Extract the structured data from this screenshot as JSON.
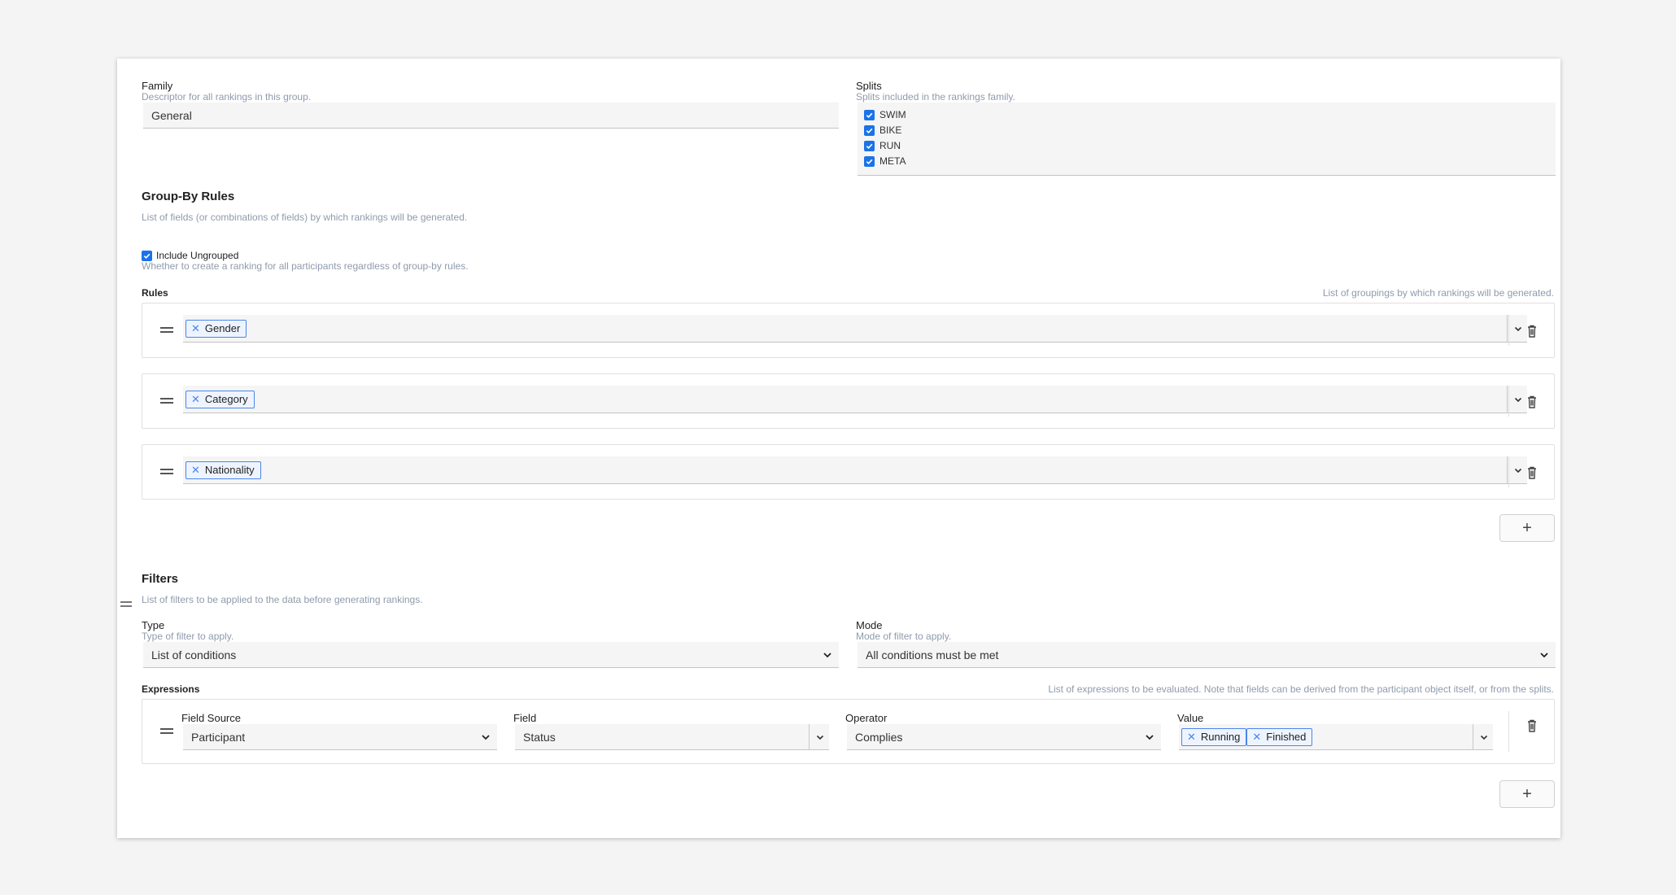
{
  "family": {
    "label": "Family",
    "description": "Descriptor for all rankings in this group.",
    "value": "General"
  },
  "splits": {
    "label": "Splits",
    "description": "Splits included in the rankings family.",
    "items": [
      {
        "label": "SWIM",
        "checked": true
      },
      {
        "label": "BIKE",
        "checked": true
      },
      {
        "label": "RUN",
        "checked": true
      },
      {
        "label": "META",
        "checked": true
      }
    ]
  },
  "group_by": {
    "title": "Group-By Rules",
    "description": "List of fields (or combinations of fields) by which rankings will be generated.",
    "include_ungrouped": {
      "label": "Include Ungrouped",
      "description": "Whether to create a ranking for all participants regardless of group-by rules.",
      "checked": true
    },
    "rules_label": "Rules",
    "rules_hint": "List of groupings by which rankings will be generated.",
    "rules": [
      {
        "tags": [
          "Gender"
        ]
      },
      {
        "tags": [
          "Category"
        ]
      },
      {
        "tags": [
          "Nationality"
        ]
      }
    ],
    "add_label": "+"
  },
  "filters": {
    "title": "Filters",
    "description": "List of filters to be applied to the data before generating rankings.",
    "type": {
      "label": "Type",
      "description": "Type of filter to apply.",
      "value": "List of conditions"
    },
    "mode": {
      "label": "Mode",
      "description": "Mode of filter to apply.",
      "value": "All conditions must be met"
    },
    "expressions_label": "Expressions",
    "expressions_hint": "List of expressions to be evaluated. Note that fields can be derived from the participant object itself, or from the splits.",
    "expression": {
      "field_source_label": "Field Source",
      "field_source_value": "Participant",
      "field_label": "Field",
      "field_value": "Status",
      "operator_label": "Operator",
      "operator_value": "Complies",
      "value_label": "Value",
      "value_tags": [
        "Running",
        "Finished"
      ]
    },
    "add_label": "+"
  },
  "colors": {
    "accent": "#1a73e8",
    "tag_border": "#4a86e8",
    "muted_text": "#8f9bab"
  }
}
